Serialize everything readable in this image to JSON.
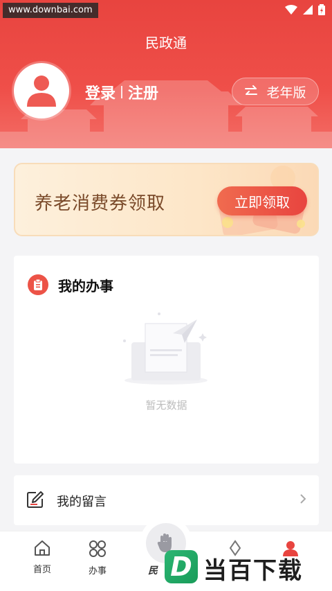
{
  "status": {
    "watermark": "www.downbai.com"
  },
  "header": {
    "title": "民政通",
    "login_label": "登录",
    "register_label": "注册",
    "elder_mode_label": "老年版"
  },
  "banner": {
    "title": "养老消费券领取",
    "button_label": "立即领取"
  },
  "my_affairs": {
    "title": "我的办事",
    "empty_text": "暂无数据"
  },
  "my_messages": {
    "label": "我的留言"
  },
  "tabbar": {
    "tabs": [
      {
        "label": "首页",
        "icon": "home-icon"
      },
      {
        "label": "办事",
        "icon": "grid-icon"
      },
      {
        "label": "民",
        "icon": "hand-icon"
      }
    ]
  },
  "logo": {
    "letter": "D",
    "text": "当百下载"
  },
  "colors": {
    "primary": "#e8443f",
    "banner_text": "#7a4a2a"
  }
}
